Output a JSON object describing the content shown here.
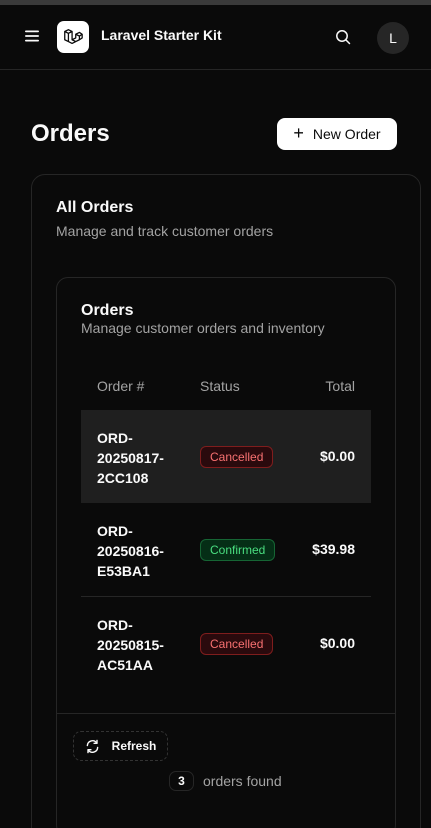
{
  "header": {
    "app_title": "Laravel Starter Kit",
    "avatar_initial": "L",
    "icons": {
      "menu": "menu-icon",
      "logo": "laravel-logo-icon",
      "search": "search-icon"
    }
  },
  "page": {
    "title": "Orders",
    "new_order_label": "New Order"
  },
  "outer_card": {
    "title": "All Orders",
    "description": "Manage and track customer orders"
  },
  "inner_card": {
    "title": "Orders",
    "description": "Manage customer orders and inventory"
  },
  "table": {
    "columns": [
      "Order #",
      "Status",
      "Total"
    ],
    "rows": [
      {
        "order_id_lines": [
          "ORD-",
          "20250817-",
          "2CC108"
        ],
        "status": "Cancelled",
        "total": "$0.00"
      },
      {
        "order_id_lines": [
          "ORD-",
          "20250816-",
          "E53BA1"
        ],
        "status": "Confirmed",
        "total": "$39.98"
      },
      {
        "order_id_lines": [
          "ORD-",
          "20250815-",
          "AC51AA"
        ],
        "status": "Cancelled",
        "total": "$0.00"
      }
    ]
  },
  "footer": {
    "refresh_label": "Refresh",
    "count": "3",
    "count_text": "orders found"
  },
  "colors": {
    "background": "#0a0a0a",
    "cancelled": "#f87171",
    "confirmed": "#4ade80",
    "row_highlight": "#1f1f1f"
  }
}
